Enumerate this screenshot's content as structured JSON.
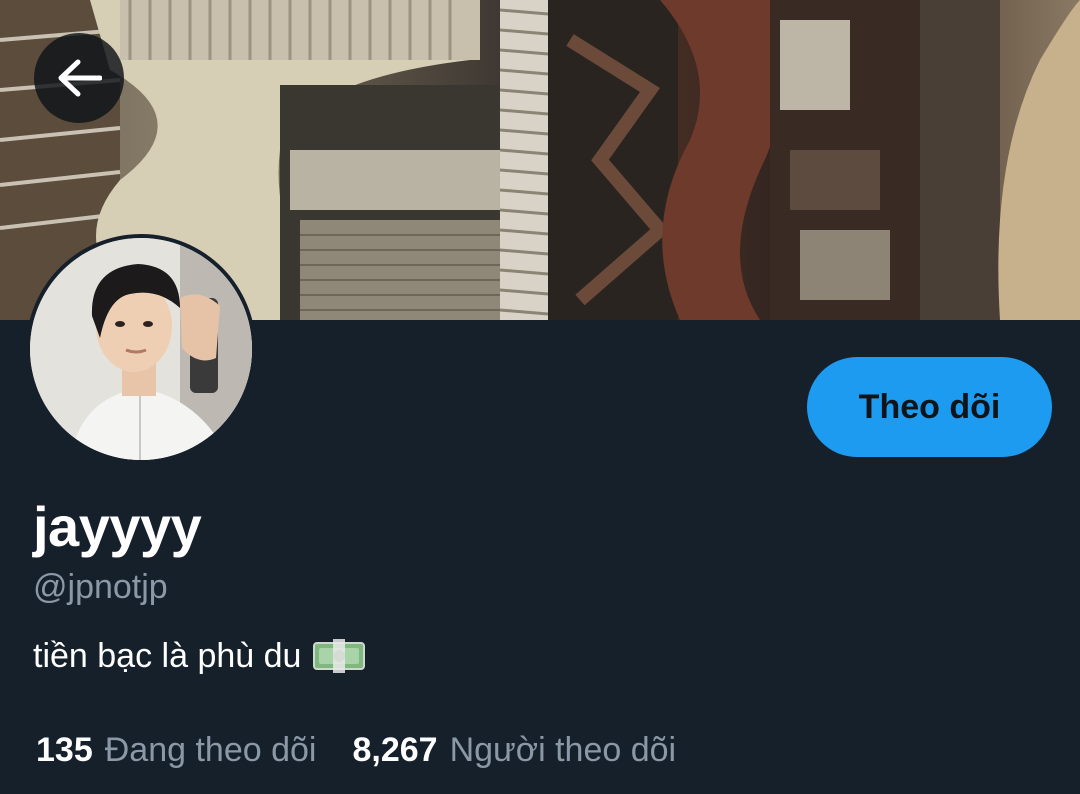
{
  "header": {
    "back_icon": "arrow-left-icon"
  },
  "profile": {
    "display_name": "jayyyy",
    "handle": "@jpnotjp",
    "bio_text": "tiền bạc là phù du",
    "bio_emoji_icon": "money-banknote-icon",
    "follow_label": "Theo dõi"
  },
  "stats": {
    "following_count": "135",
    "following_label": "Đang theo dõi",
    "followers_count": "8,267",
    "followers_label": "Người theo dõi"
  },
  "colors": {
    "background": "#15202b",
    "accent": "#1d9bf0",
    "text_primary": "#ffffff",
    "text_secondary": "#8b98a5"
  }
}
